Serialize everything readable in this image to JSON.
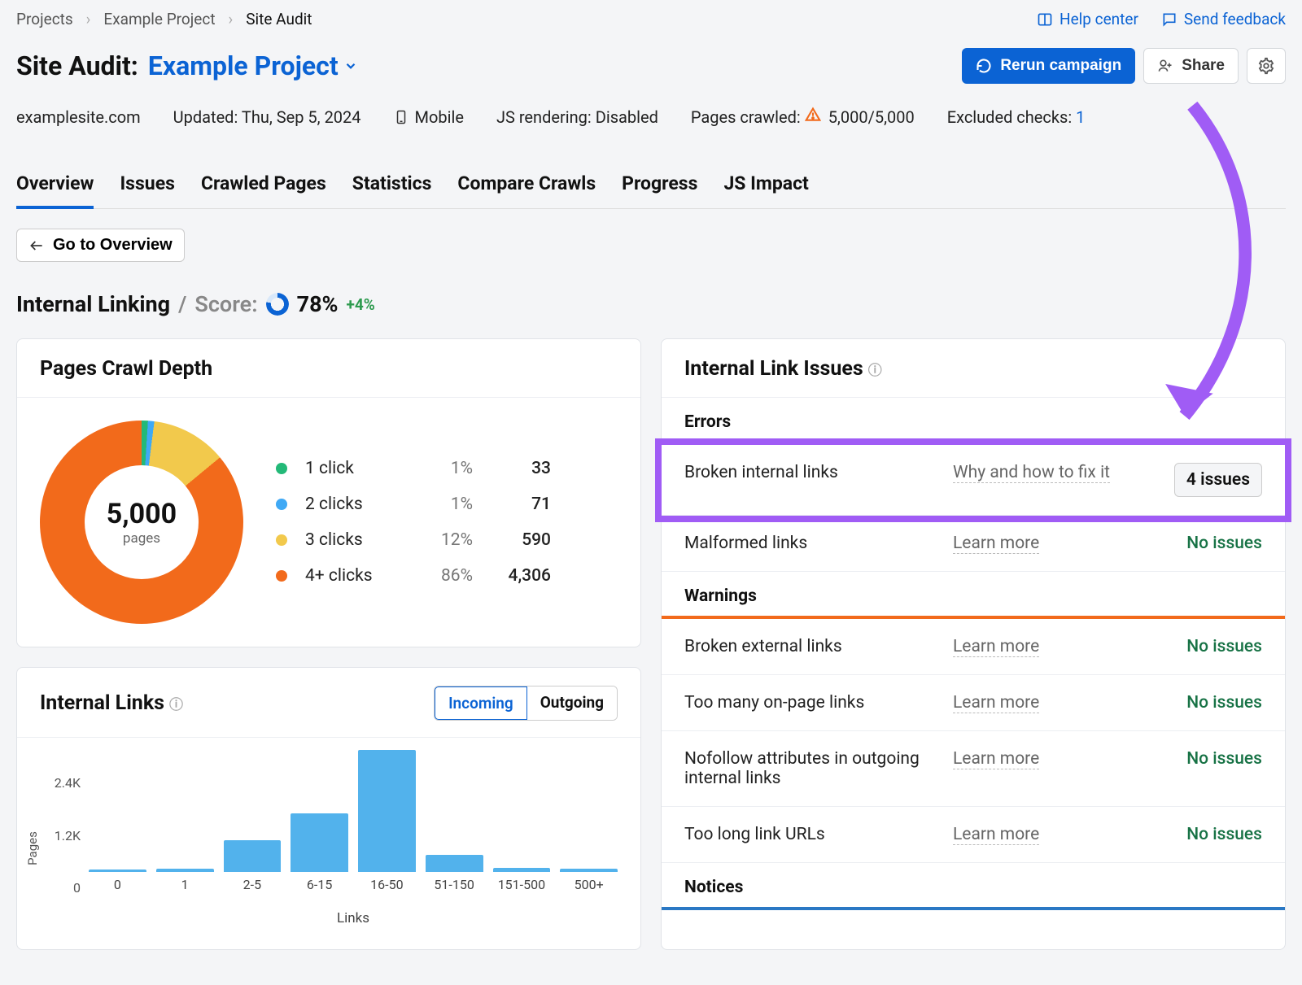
{
  "breadcrumbs": {
    "root": "Projects",
    "project": "Example Project",
    "page": "Site Audit"
  },
  "top_links": {
    "help": "Help center",
    "feedback": "Send feedback"
  },
  "title": {
    "prefix": "Site Audit:",
    "project": "Example Project"
  },
  "actions": {
    "rerun": "Rerun campaign",
    "share": "Share"
  },
  "meta": {
    "domain": "examplesite.com",
    "updated_label": "Updated:",
    "updated_value": "Thu, Sep 5, 2024",
    "device": "Mobile",
    "js_label": "JS rendering:",
    "js_value": "Disabled",
    "crawled_label": "Pages crawled:",
    "crawled_value": "5,000/5,000",
    "excluded_label": "Excluded checks:",
    "excluded_value": "1"
  },
  "tabs": [
    "Overview",
    "Issues",
    "Crawled Pages",
    "Statistics",
    "Compare Crawls",
    "Progress",
    "JS Impact"
  ],
  "active_tab": 0,
  "go_back": "Go to Overview",
  "section": {
    "name": "Internal Linking",
    "score_label": "Score:",
    "score": "78%",
    "delta": "+4%"
  },
  "crawl_depth": {
    "title": "Pages Crawl Depth",
    "center_num": "5,000",
    "center_sub": "pages",
    "rows": [
      {
        "label": "1 click",
        "pct": "1%",
        "count": "33",
        "color": "#23b978"
      },
      {
        "label": "2 clicks",
        "pct": "1%",
        "count": "71",
        "color": "#3fa9f5"
      },
      {
        "label": "3 clicks",
        "pct": "12%",
        "count": "590",
        "color": "#f2c94c"
      },
      {
        "label": "4+ clicks",
        "pct": "86%",
        "count": "4,306",
        "color": "#f26a1b"
      }
    ]
  },
  "internal_links": {
    "title": "Internal Links",
    "toggle": [
      "Incoming",
      "Outgoing"
    ],
    "active_toggle": 0,
    "ylabel": "Pages",
    "xlabel": "Links"
  },
  "chart_data": {
    "type": "bar",
    "categories": [
      "0",
      "1",
      "2-5",
      "6-15",
      "16-50",
      "51-150",
      "151-500",
      "500+"
    ],
    "values": [
      40,
      60,
      620,
      1150,
      2400,
      340,
      80,
      60
    ],
    "y_ticks": [
      "2.4K",
      "1.2K",
      "0"
    ],
    "ylabel": "Pages",
    "xlabel": "Links",
    "ylim": [
      0,
      2400
    ]
  },
  "issues_panel": {
    "title": "Internal Link Issues",
    "sections": {
      "errors": "Errors",
      "warnings": "Warnings",
      "notices": "Notices"
    },
    "errors": [
      {
        "name": "Broken internal links",
        "hint": "Why and how to fix it",
        "status": "4 issues",
        "highlight": true
      },
      {
        "name": "Malformed links",
        "hint": "Learn more",
        "status": "No issues"
      }
    ],
    "warnings": [
      {
        "name": "Broken external links",
        "hint": "Learn more",
        "status": "No issues"
      },
      {
        "name": "Too many on-page links",
        "hint": "Learn more",
        "status": "No issues"
      },
      {
        "name": "Nofollow attributes in outgoing internal links",
        "hint": "Learn more",
        "status": "No issues"
      },
      {
        "name": "Too long link URLs",
        "hint": "Learn more",
        "status": "No issues"
      }
    ]
  }
}
